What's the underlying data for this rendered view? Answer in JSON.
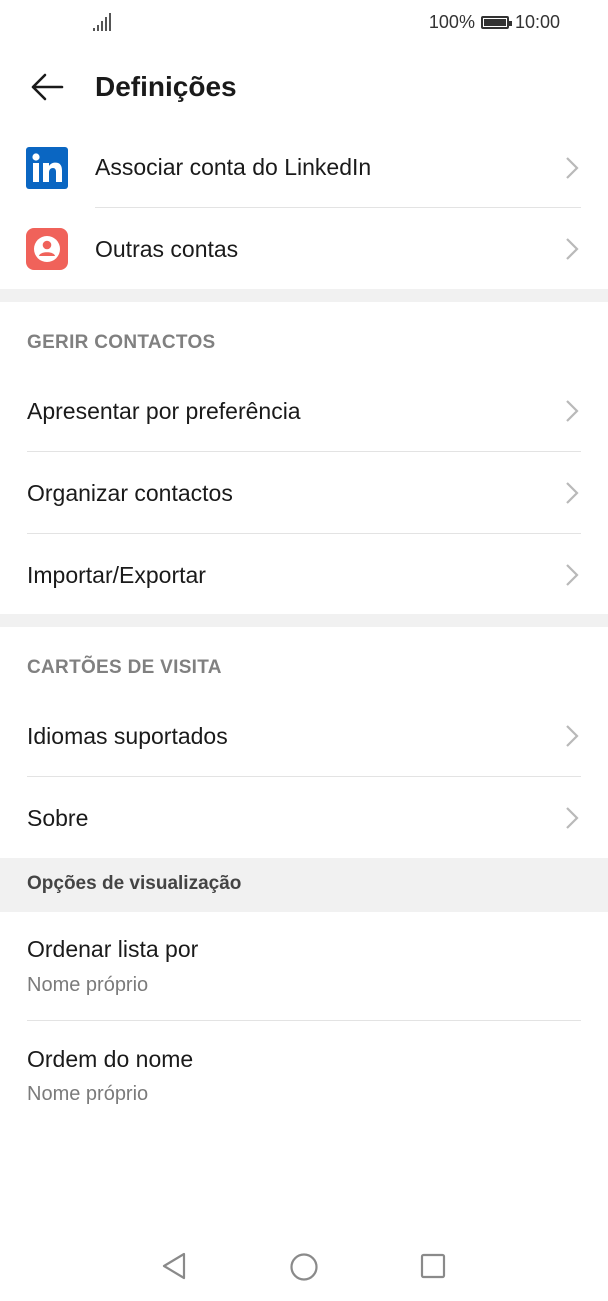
{
  "status": {
    "battery": "100%",
    "time": "10:00"
  },
  "header": {
    "title": "Definições"
  },
  "accounts": [
    {
      "label": "Associar conta do LinkedIn",
      "icon": "linkedin-icon"
    },
    {
      "label": "Outras contas",
      "icon": "account-icon"
    }
  ],
  "manage": {
    "title": "GERIR CONTACTOS",
    "items": [
      {
        "label": "Apresentar por preferência"
      },
      {
        "label": "Organizar contactos"
      },
      {
        "label": "Importar/Exportar"
      }
    ]
  },
  "cards": {
    "title": "CARTÕES DE VISITA",
    "items": [
      {
        "label": "Idiomas suportados"
      },
      {
        "label": "Sobre"
      }
    ]
  },
  "display": {
    "title": "Opções de visualização",
    "items": [
      {
        "label": "Ordenar lista por",
        "value": "Nome próprio"
      },
      {
        "label": "Ordem do nome",
        "value": "Nome próprio"
      }
    ]
  },
  "colors": {
    "linkedin": "#0a66c2",
    "account": "#f0625a",
    "section": "#808080"
  }
}
